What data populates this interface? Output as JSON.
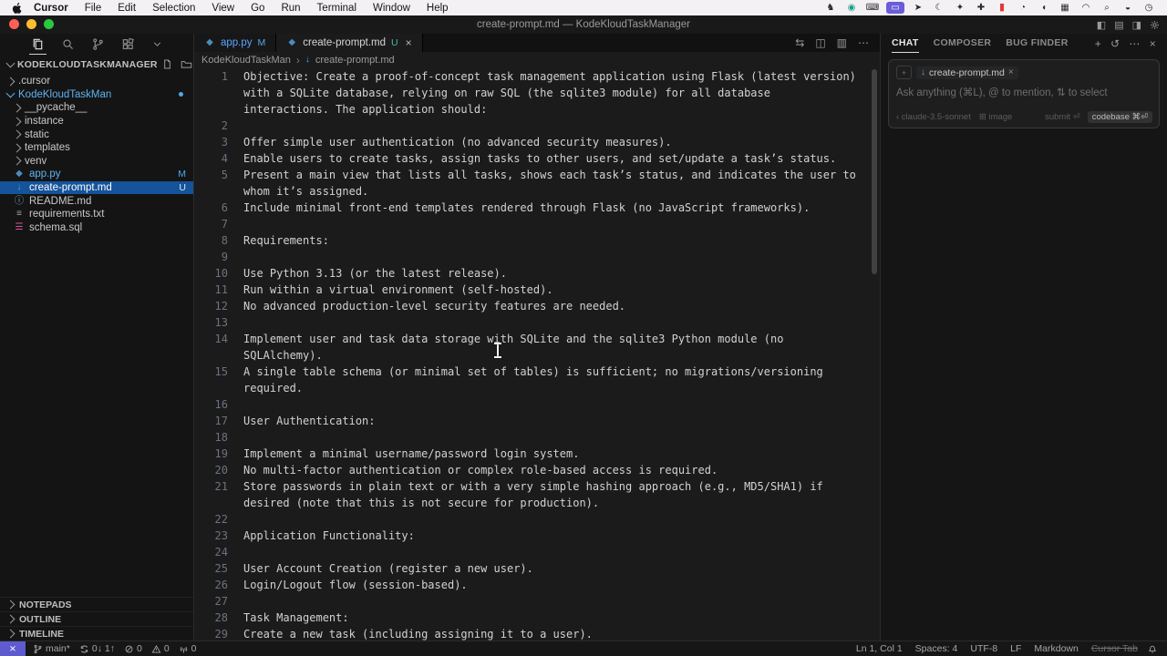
{
  "menu_bar": {
    "items": [
      {
        "t": "Cursor",
        "cls": "bold"
      },
      {
        "t": "File"
      },
      {
        "t": "Edit"
      },
      {
        "t": "Selection"
      },
      {
        "t": "View"
      },
      {
        "t": "Go"
      },
      {
        "t": "Run"
      },
      {
        "t": "Terminal"
      },
      {
        "t": "Window"
      },
      {
        "t": "Help"
      }
    ],
    "status_icons": [
      {
        "name": "app-pet-icon",
        "glyph": "♞"
      },
      {
        "name": "browser-icon",
        "glyph": "◉",
        "cls": "teal"
      },
      {
        "name": "keyboard-icon",
        "glyph": "⌨"
      },
      {
        "name": "screen-share-icon",
        "glyph": "▭",
        "cls": "hl"
      },
      {
        "name": "arrow-icon",
        "glyph": "➤"
      },
      {
        "name": "moon-icon",
        "glyph": "☾"
      },
      {
        "name": "dropbox-icon",
        "glyph": "✦"
      },
      {
        "name": "plus-app-icon",
        "glyph": "✚"
      },
      {
        "name": "battery-icon",
        "glyph": "▮",
        "cls": "red"
      },
      {
        "name": "timer-icon",
        "glyph": "◔"
      },
      {
        "name": "volume-icon",
        "glyph": "◖"
      },
      {
        "name": "grid-icon",
        "glyph": "▦"
      },
      {
        "name": "wifi-icon",
        "glyph": "◠"
      },
      {
        "name": "search-icon",
        "glyph": "⌕"
      },
      {
        "name": "user-switch-icon",
        "glyph": "◒"
      },
      {
        "name": "clock-icon",
        "glyph": "◷"
      }
    ]
  },
  "window": {
    "title": "create-prompt.md — KodeKloudTaskManager"
  },
  "explorer": {
    "title": "KODEKLOUDTASKMANAGER",
    "items": [
      {
        "label": ".cursor",
        "cls": "chev-r",
        "ind": 0
      },
      {
        "label": "KodeKloudTaskMan",
        "cls": "chev-d accent dot",
        "ind": 0
      },
      {
        "label": "__pycache__",
        "cls": "chev-r",
        "ind": 1
      },
      {
        "label": "instance",
        "cls": "chev-r",
        "ind": 1
      },
      {
        "label": "static",
        "cls": "chev-r",
        "ind": 1
      },
      {
        "label": "templates",
        "cls": "chev-r",
        "ind": 1
      },
      {
        "label": "venv",
        "cls": "chev-r",
        "ind": 1
      },
      {
        "label": "app.py",
        "icon": "py",
        "icon_name": "python-file-icon",
        "badge": "M",
        "cls": "accent bM",
        "ind": 1
      },
      {
        "label": "create-prompt.md",
        "icon": "md",
        "icon_name": "markdown-file-icon",
        "badge": "U",
        "cls": "sel bU",
        "ind": 1
      },
      {
        "label": "README.md",
        "icon": "info",
        "icon_name": "info-file-icon",
        "ind": 1
      },
      {
        "label": "requirements.txt",
        "icon": "list",
        "icon_name": "text-file-icon",
        "ind": 1
      },
      {
        "label": "schema.sql",
        "icon": "db",
        "icon_name": "database-file-icon",
        "ind": 1
      }
    ],
    "sections": [
      {
        "t": "NOTEPADS"
      },
      {
        "t": "OUTLINE"
      },
      {
        "t": "TIMELINE"
      }
    ]
  },
  "tabs": [
    {
      "label": "app.py",
      "badge": "M",
      "cls": "mod bM"
    },
    {
      "label": "create-prompt.md",
      "badge": "U",
      "cls": "active bU",
      "close": "×"
    }
  ],
  "breadcrumb": {
    "folder": "KodeKloudTaskMan",
    "file": "create-prompt.md"
  },
  "editor": {
    "lines": [
      {
        "n": "1",
        "t": "Objective: Create a proof-of-concept task management application using Flask (latest version) with a SQLite database, relying on raw SQL (the sqlite3 module) for all database interactions. The application should:"
      },
      {
        "n": "2",
        "t": ""
      },
      {
        "n": "3",
        "t": "Offer simple user authentication (no advanced security measures)."
      },
      {
        "n": "4",
        "t": "Enable users to create tasks, assign tasks to other users, and set/update a task’s status."
      },
      {
        "n": "5",
        "t": "Present a main view that lists all tasks, shows each task’s status, and indicates the user to whom it’s assigned."
      },
      {
        "n": "6",
        "t": "Include minimal front-end templates rendered through Flask (no JavaScript frameworks)."
      },
      {
        "n": "7",
        "t": ""
      },
      {
        "n": "8",
        "t": "Requirements:"
      },
      {
        "n": "9",
        "t": ""
      },
      {
        "n": "10",
        "t": "Use Python 3.13 (or the latest release)."
      },
      {
        "n": "11",
        "t": "Run within a virtual environment (self-hosted)."
      },
      {
        "n": "12",
        "t": "No advanced production-level security features are needed."
      },
      {
        "n": "13",
        "t": ""
      },
      {
        "n": "14",
        "t": "Implement user and task data storage with SQLite and the sqlite3 Python module (no SQLAlchemy)."
      },
      {
        "n": "15",
        "t": "A single table schema (or minimal set of tables) is sufficient; no migrations/versioning required."
      },
      {
        "n": "16",
        "t": ""
      },
      {
        "n": "17",
        "t": "User Authentication:"
      },
      {
        "n": "18",
        "t": ""
      },
      {
        "n": "19",
        "t": "Implement a minimal username/password login system."
      },
      {
        "n": "20",
        "t": "No multi-factor authentication or complex role-based access is required."
      },
      {
        "n": "21",
        "t": "Store passwords in plain text or with a very simple hashing approach (e.g., MD5/SHA1) if desired (note that this is not secure for production)."
      },
      {
        "n": "22",
        "t": ""
      },
      {
        "n": "23",
        "t": "Application Functionality:"
      },
      {
        "n": "24",
        "t": ""
      },
      {
        "n": "25",
        "t": "User Account Creation (register a new user)."
      },
      {
        "n": "26",
        "t": "Login/Logout flow (session-based)."
      },
      {
        "n": "27",
        "t": ""
      },
      {
        "n": "28",
        "t": "Task Management:"
      },
      {
        "n": "29",
        "t": "Create a new task (including assigning it to a user)."
      }
    ]
  },
  "chat": {
    "tabs": [
      {
        "t": "CHAT",
        "cls": "active"
      },
      {
        "t": "COMPOSER"
      },
      {
        "t": "BUG FINDER"
      }
    ],
    "chip": "create-prompt.md",
    "chip_close": "×",
    "placeholder": "Ask anything (⌘L), @ to mention, ⇅ to select",
    "model": "‹ claude-3.5-sonnet",
    "image_label": "⊞ image",
    "submit_label": "submit ⏎",
    "codebase_label": "codebase ⌘⏎"
  },
  "status_bar": {
    "branch": "main*",
    "sync": "0↓ 1↑",
    "errors": "0",
    "warnings": "0",
    "ports": "0",
    "right": [
      {
        "t": "Ln 1, Col 1"
      },
      {
        "t": "Spaces: 4"
      },
      {
        "t": "UTF-8"
      },
      {
        "t": "LF"
      },
      {
        "t": "Markdown"
      },
      {
        "t": "Cursor Tab",
        "cls": "strike"
      }
    ]
  },
  "colors": {
    "accent_blue": "#4fa8e8",
    "selection": "#15539b",
    "remote": "#5e5bd0",
    "untracked": "#4db6ac"
  }
}
